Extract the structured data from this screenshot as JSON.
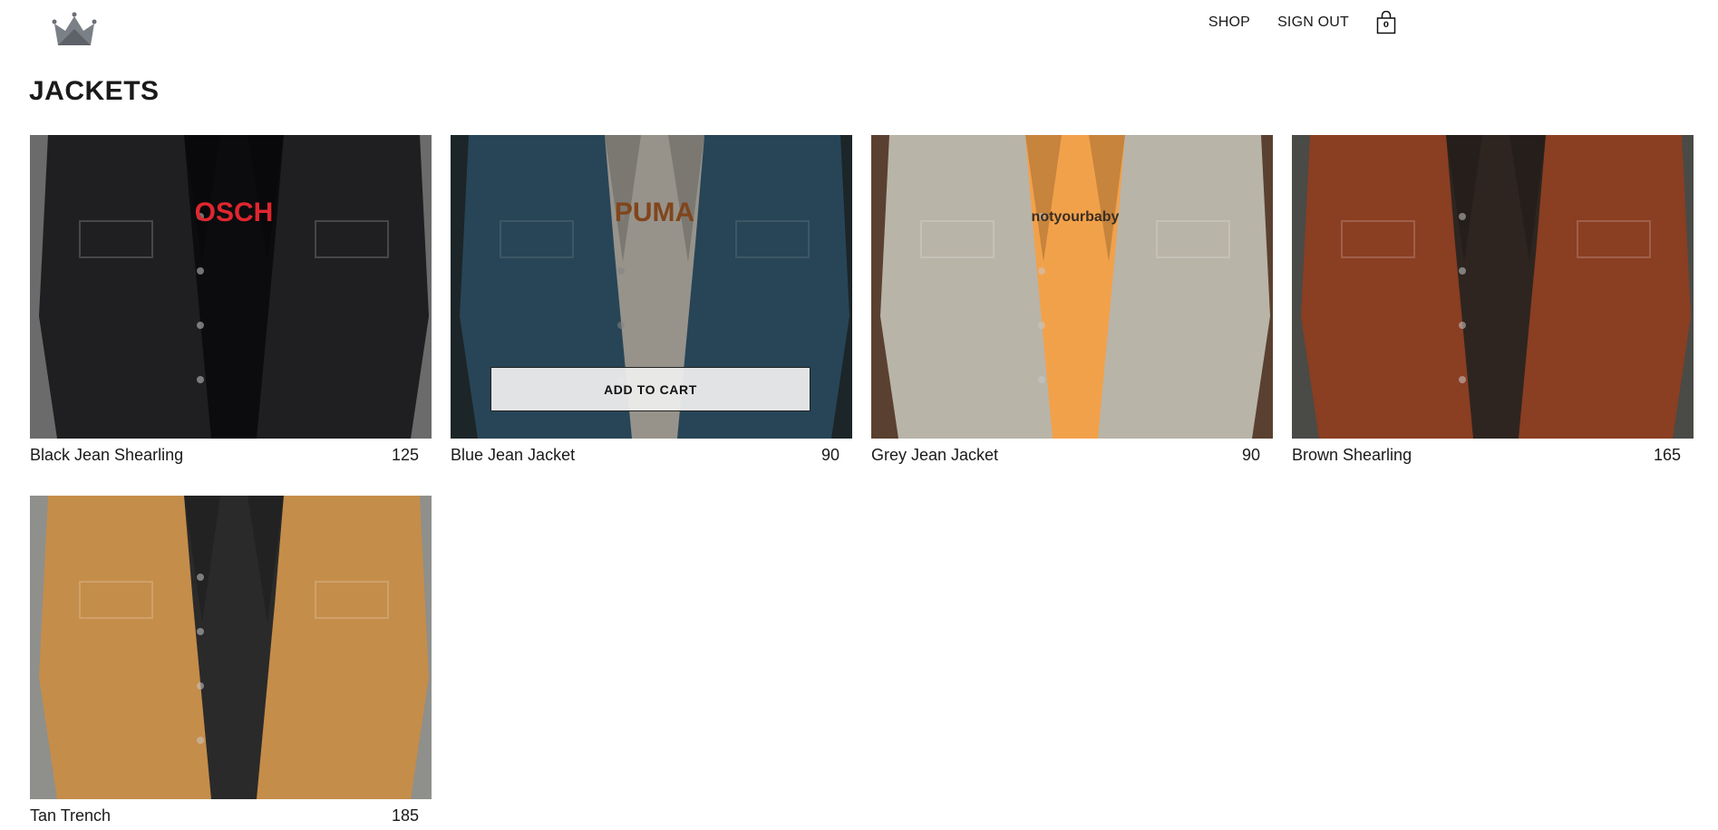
{
  "header": {
    "logo_icon": "crown-icon",
    "nav": [
      {
        "label": "SHOP"
      },
      {
        "label": "SIGN OUT"
      }
    ],
    "cart": {
      "icon": "shopping-bag-icon",
      "count": "0"
    }
  },
  "page": {
    "title": "JACKETS"
  },
  "products": [
    {
      "name": "Black Jean Shearling",
      "price": "125",
      "colors": {
        "bg": "#6b6b6b",
        "garment": "#1f1f21",
        "inner": "#0c0c0e",
        "accent": "#e0262e"
      },
      "print": "OSCH"
    },
    {
      "name": "Blue Jean Jacket",
      "price": "90",
      "colors": {
        "bg": "#2b3a3e",
        "garment": "#3d6a86",
        "inner": "#e8e2d6",
        "accent": "#c76a2b"
      },
      "print": "PUMA",
      "hover": true,
      "cta_label": "ADD TO CART"
    },
    {
      "name": "Grey Jean Jacket",
      "price": "90",
      "colors": {
        "bg": "#5a4030",
        "garment": "#b9b4a8",
        "inner": "#f2a14b",
        "accent": "#3b2e22"
      },
      "print": "notyourbaby"
    },
    {
      "name": "Brown Shearling",
      "price": "165",
      "colors": {
        "bg": "#4a4a46",
        "garment": "#8a3e22",
        "inner": "#2e2520",
        "accent": "#c9c3b8"
      },
      "print": ""
    },
    {
      "name": "Tan Trench",
      "price": "185",
      "colors": {
        "bg": "#8f8f8c",
        "garment": "#c58d4a",
        "inner": "#2a2a2a",
        "accent": "#a77236"
      },
      "print": ""
    }
  ]
}
